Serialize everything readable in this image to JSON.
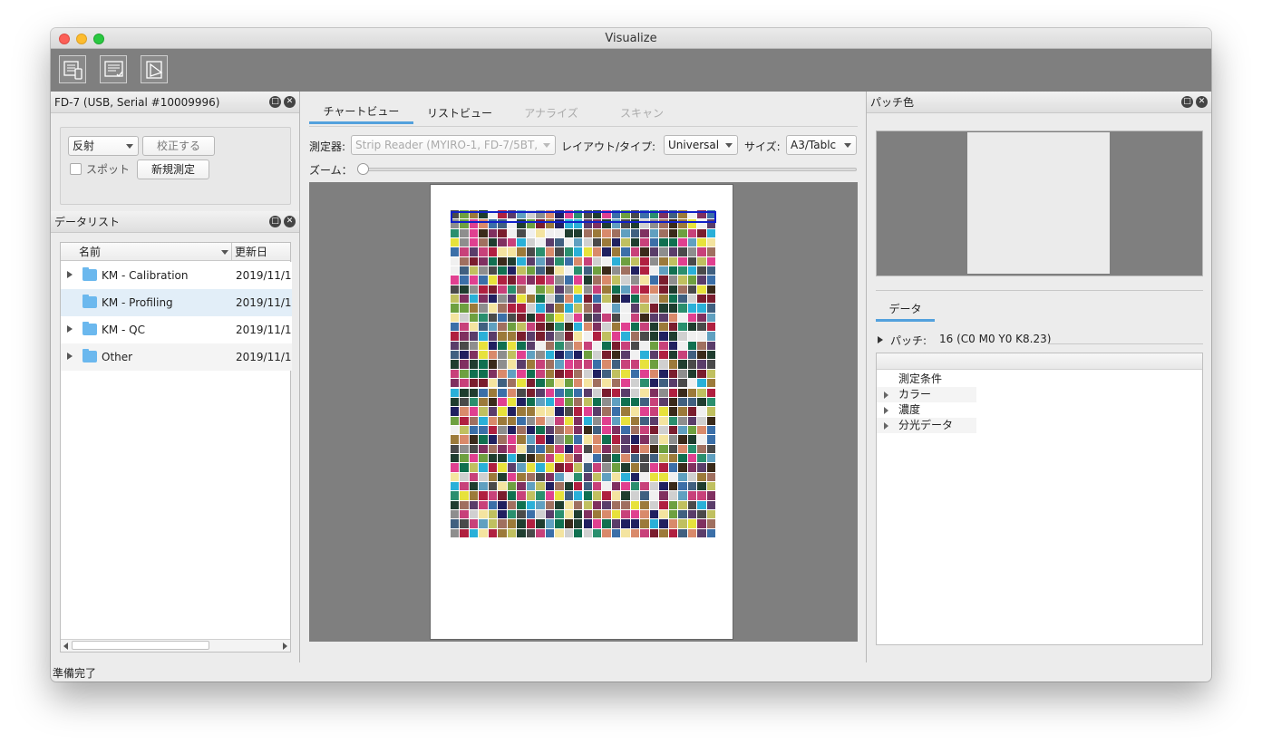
{
  "window": {
    "title": "Visualize"
  },
  "device_panel": {
    "title": "FD-7 (USB, Serial #10009996)",
    "mode_select": "反射",
    "calibrate_button": "校正する",
    "spot_label": "スポット",
    "new_measure_button": "新規測定"
  },
  "data_list": {
    "title": "データリスト",
    "col_name": "名前",
    "col_date": "更新日",
    "rows": [
      {
        "name": "KM - Calibration",
        "date": "2019/11/1",
        "expandable": true,
        "selected": false
      },
      {
        "name": "KM - Profiling",
        "date": "2019/11/1",
        "expandable": false,
        "selected": true
      },
      {
        "name": "KM - QC",
        "date": "2019/11/1",
        "expandable": true,
        "selected": false
      },
      {
        "name": "Other",
        "date": "2019/11/1",
        "expandable": true,
        "selected": false
      }
    ]
  },
  "status": {
    "text": "準備完了"
  },
  "center": {
    "tabs": [
      {
        "label": "チャートビュー",
        "active": true
      },
      {
        "label": "リストビュー",
        "active": false
      },
      {
        "label": "アナライズ",
        "active": false,
        "disabled": true
      },
      {
        "label": "スキャン",
        "active": false,
        "disabled": true
      }
    ],
    "instrument_label": "測定器:",
    "instrument_value": "Strip Reader (MYIRO-1, FD-7/5BT,",
    "layout_label": "レイアウト/タイプ:",
    "layout_value": "Universal",
    "size_label": "サイズ:",
    "size_value": "A3/Tablc",
    "zoom_label": "ズーム："
  },
  "patch_panel": {
    "title": "パッチ色",
    "data_tab": "データ",
    "patch_label": "パッチ:",
    "patch_value": "16 (C0 M0 Y0 K8.23)",
    "tree": [
      {
        "label": "測定条件",
        "expandable": false
      },
      {
        "label": "カラー",
        "expandable": true
      },
      {
        "label": "濃度",
        "expandable": true
      },
      {
        "label": "分光データ",
        "expandable": true
      }
    ]
  },
  "colors": {
    "accent": "#53a1dd",
    "toolbar_bg": "#7f7f7f",
    "selection_bg": "#e2eef8",
    "chart_border": "#1020c8"
  }
}
